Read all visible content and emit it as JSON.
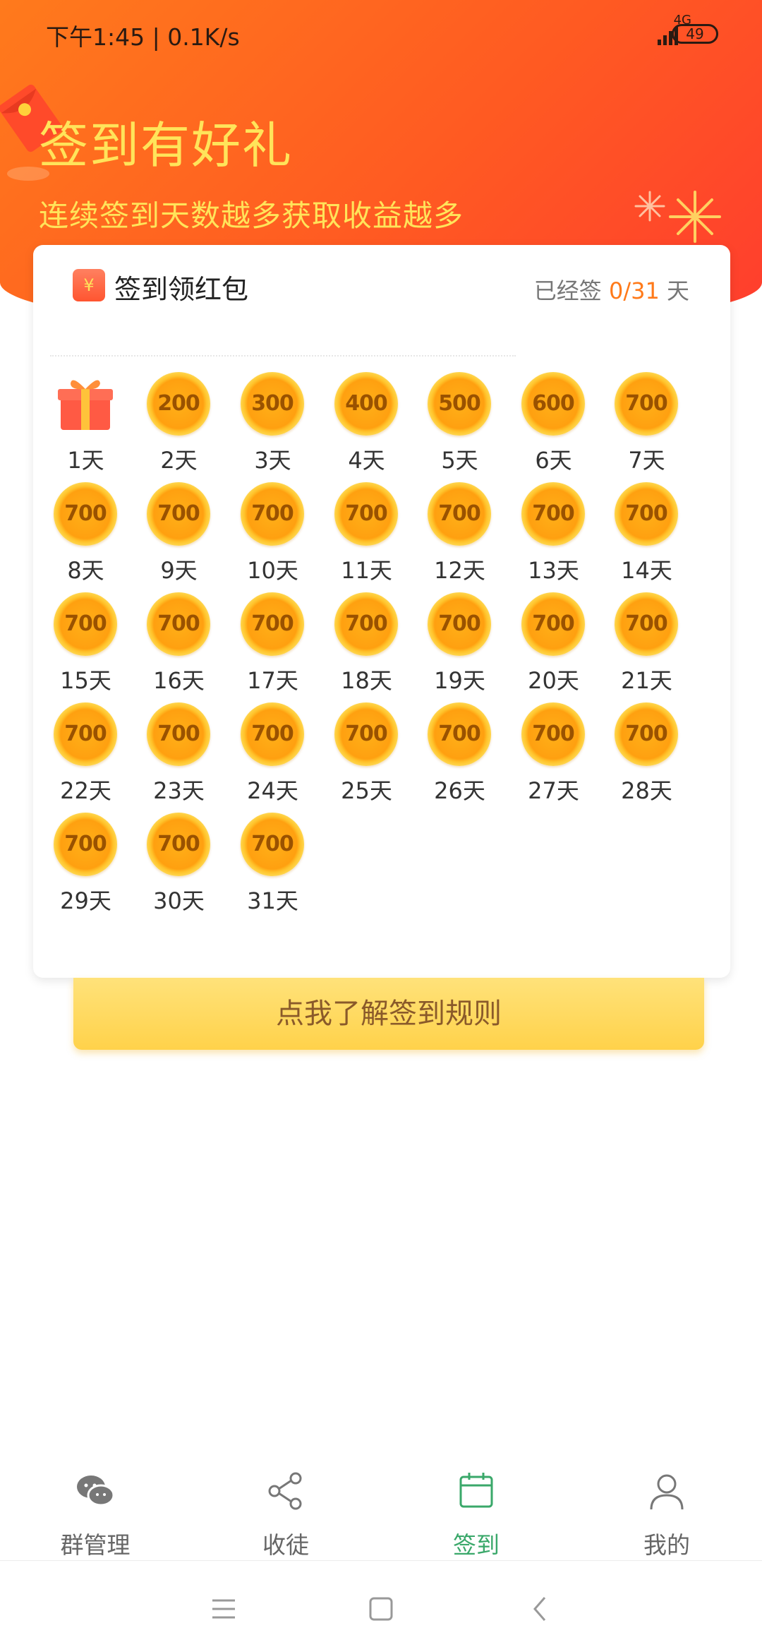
{
  "status": {
    "time": "下午1:45 | 0.1K/s",
    "network": "4G",
    "battery": "49"
  },
  "hero": {
    "title": "签到有好礼",
    "subtitle": "连续签到天数越多获取收益越多"
  },
  "card": {
    "title": "签到领红包",
    "progress_prefix": "已经签 ",
    "progress_count": "0/31",
    "progress_suffix": " 天"
  },
  "days": [
    {
      "day": "1天",
      "reward": "gift"
    },
    {
      "day": "2天",
      "reward": "200"
    },
    {
      "day": "3天",
      "reward": "300"
    },
    {
      "day": "4天",
      "reward": "400"
    },
    {
      "day": "5天",
      "reward": "500"
    },
    {
      "day": "6天",
      "reward": "600"
    },
    {
      "day": "7天",
      "reward": "700"
    },
    {
      "day": "8天",
      "reward": "700"
    },
    {
      "day": "9天",
      "reward": "700"
    },
    {
      "day": "10天",
      "reward": "700"
    },
    {
      "day": "11天",
      "reward": "700"
    },
    {
      "day": "12天",
      "reward": "700"
    },
    {
      "day": "13天",
      "reward": "700"
    },
    {
      "day": "14天",
      "reward": "700"
    },
    {
      "day": "15天",
      "reward": "700"
    },
    {
      "day": "16天",
      "reward": "700"
    },
    {
      "day": "17天",
      "reward": "700"
    },
    {
      "day": "18天",
      "reward": "700"
    },
    {
      "day": "19天",
      "reward": "700"
    },
    {
      "day": "20天",
      "reward": "700"
    },
    {
      "day": "21天",
      "reward": "700"
    },
    {
      "day": "22天",
      "reward": "700"
    },
    {
      "day": "23天",
      "reward": "700"
    },
    {
      "day": "24天",
      "reward": "700"
    },
    {
      "day": "25天",
      "reward": "700"
    },
    {
      "day": "26天",
      "reward": "700"
    },
    {
      "day": "27天",
      "reward": "700"
    },
    {
      "day": "28天",
      "reward": "700"
    },
    {
      "day": "29天",
      "reward": "700"
    },
    {
      "day": "30天",
      "reward": "700"
    },
    {
      "day": "31天",
      "reward": "700"
    }
  ],
  "rules_button": "点我了解签到规则",
  "nav": {
    "items": [
      {
        "label": "群管理",
        "icon": "wechat-icon"
      },
      {
        "label": "收徒",
        "icon": "share-icon"
      },
      {
        "label": "签到",
        "icon": "calendar-icon",
        "active": true
      },
      {
        "label": "我的",
        "icon": "user-icon"
      }
    ]
  },
  "colors": {
    "accent_green": "#3aa86a",
    "hero_orange": "#ff6a20",
    "coin_gold": "#ffa010",
    "progress_orange": "#ff7a1a"
  }
}
